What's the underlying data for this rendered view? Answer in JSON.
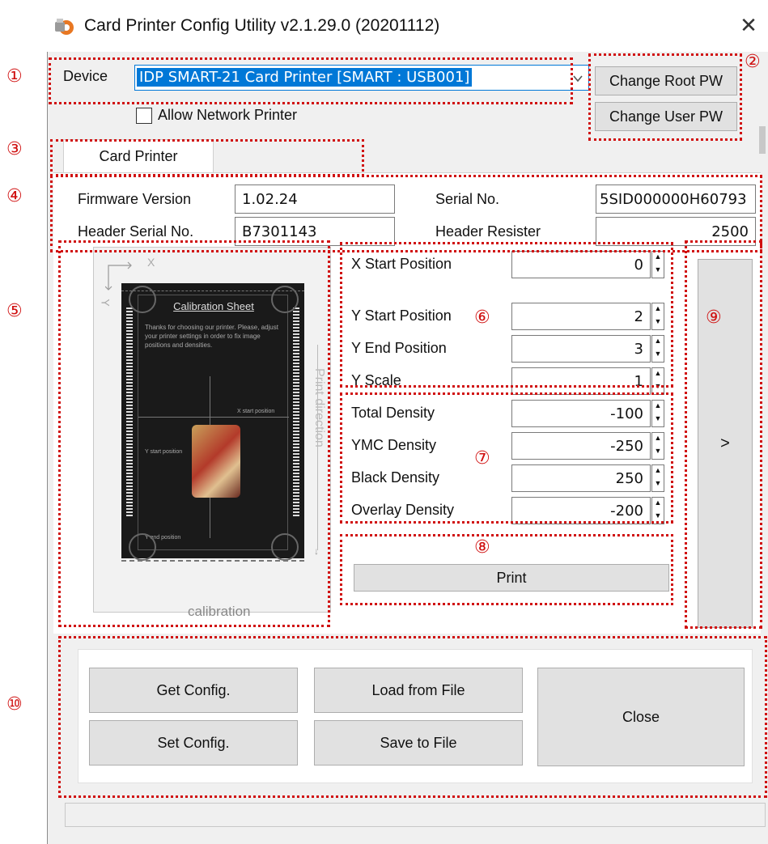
{
  "window": {
    "title": "Card Printer Config Utility v2.1.29.0 (20201112)",
    "close_glyph": "✕"
  },
  "markers": [
    "①",
    "②",
    "③",
    "④",
    "⑤",
    "⑥",
    "⑦",
    "⑧",
    "⑨",
    "⑩"
  ],
  "device": {
    "label": "Device",
    "selected": "IDP SMART-21 Card Printer  [SMART : USB001]",
    "allow_network_label": "Allow Network Printer",
    "allow_network_checked": false
  },
  "buttons": {
    "change_root_pw": "Change Root PW",
    "change_user_pw": "Change User PW",
    "print": "Print",
    "next": ">",
    "get_config": "Get Config.",
    "set_config": "Set Config.",
    "load_from_file": "Load from File",
    "save_to_file": "Save to File",
    "close": "Close"
  },
  "tabs": [
    {
      "label": "Card Printer",
      "active": true
    }
  ],
  "info": {
    "firmware_version_label": "Firmware Version",
    "firmware_version": "1.02.24",
    "serial_no_label": "Serial No.",
    "serial_no": "5SID000000H60793",
    "header_serial_label": "Header Serial No.",
    "header_serial": "B7301143",
    "header_resister_label": "Header Resister",
    "header_resister": "2500"
  },
  "calibration": {
    "axis_x": "X",
    "axis_y": "Y",
    "sheet_title": "Calibration Sheet",
    "sheet_text": "Thanks for choosing our printer. Please, adjust your printer settings in order to fix image positions and densities.",
    "x_start_label": "X start position",
    "y_start_label": "Y start position",
    "y_end_label": "Y end position",
    "print_direction": "Print direction",
    "caption": "calibration"
  },
  "position": [
    {
      "label": "X Start Position",
      "value": "0"
    },
    {
      "label": "Y Start Position",
      "value": "2"
    },
    {
      "label": "Y End Position",
      "value": "3"
    },
    {
      "label": "Y Scale",
      "value": "1"
    }
  ],
  "density": [
    {
      "label": "Total Density",
      "value": "-100"
    },
    {
      "label": "YMC Density",
      "value": "-250"
    },
    {
      "label": "Black Density",
      "value": "250"
    },
    {
      "label": "Overlay Density",
      "value": "-200"
    }
  ],
  "colors": {
    "highlight": "#d01010",
    "accent": "#0078d7",
    "window_bg": "#f0f0f0"
  },
  "icons": {
    "app": "printer-gear-icon",
    "close": "close-icon",
    "dropdown": "chevron-down-icon",
    "spin_up": "spin-up-icon",
    "spin_down": "spin-down-icon"
  }
}
